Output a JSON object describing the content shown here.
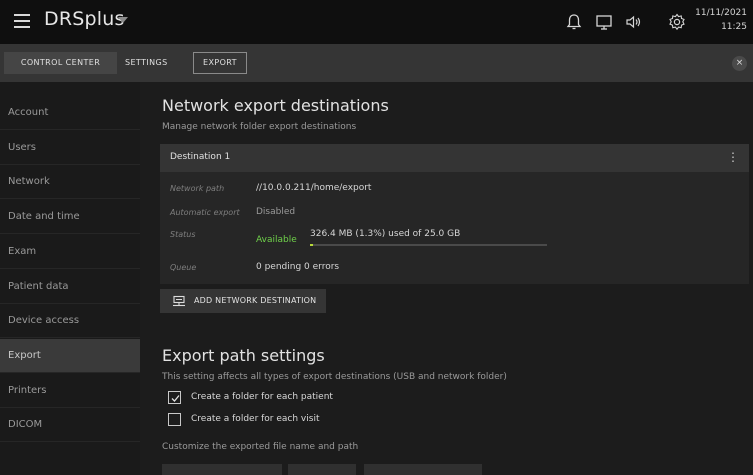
{
  "topbar": {
    "app_name": "DRSplus",
    "icons": [
      "menu-icon",
      "bell-icon",
      "monitor-icon",
      "speaker-icon",
      "gear-icon"
    ],
    "date": "11/11/2021",
    "time": "11:25"
  },
  "tabs": {
    "control_center": "CONTROL CENTER",
    "settings": "SETTINGS",
    "export": "EXPORT",
    "close": "×"
  },
  "sidebar": {
    "items": [
      {
        "label": "Account"
      },
      {
        "label": "Users"
      },
      {
        "label": "Network"
      },
      {
        "label": "Date and time"
      },
      {
        "label": "Exam"
      },
      {
        "label": "Patient data"
      },
      {
        "label": "Device access"
      },
      {
        "label": "Export",
        "active": true
      },
      {
        "label": "Printers"
      },
      {
        "label": "DICOM"
      }
    ]
  },
  "network_export": {
    "title": "Network export destinations",
    "subtitle": "Manage network folder export destinations",
    "destination": {
      "name": "Destination 1",
      "menu": "⋮",
      "network_path_label": "Network path",
      "network_path": "//10.0.0.211/home/export",
      "automatic_export_label": "Automatic export",
      "automatic_export": "Disabled",
      "status_label": "Status",
      "status": "Available",
      "usage": "326.4 MB (1.3%) used of 25.0 GB",
      "usage_fraction": 0.013,
      "queue_label": "Queue",
      "queue": "0 pending 0 errors"
    },
    "add_button": "ADD NETWORK DESTINATION"
  },
  "export_path": {
    "title": "Export path settings",
    "subtitle": "This setting affects all types of export destinations (USB and network folder)",
    "options": [
      {
        "label": "Create a folder for each patient",
        "checked": true
      },
      {
        "label": "Create a folder for each visit",
        "checked": false
      }
    ],
    "customize_label": "Customize the exported file name and path"
  },
  "colors": {
    "status_available": "#6fd04a",
    "usage_bar": "#b7d83a"
  }
}
